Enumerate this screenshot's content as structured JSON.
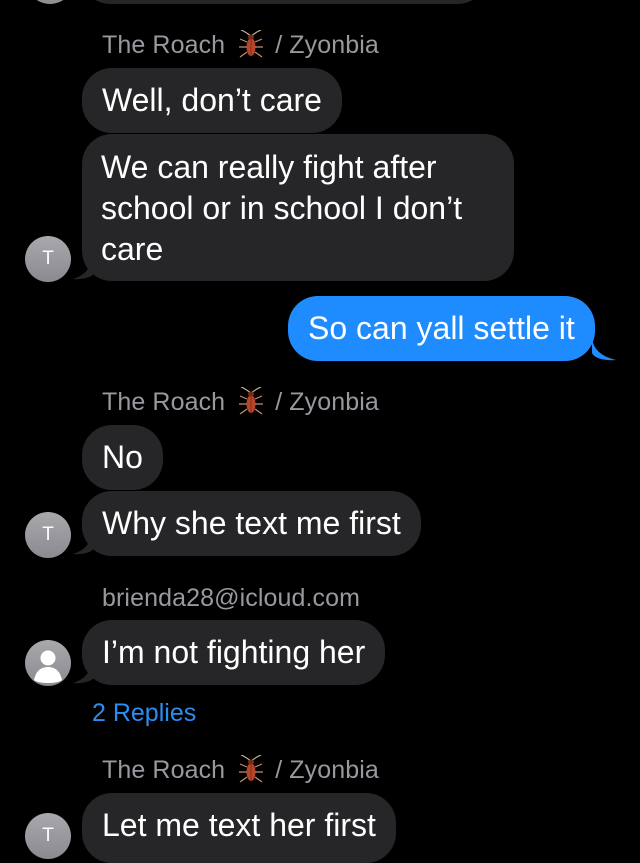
{
  "colors": {
    "background": "#000000",
    "incoming_bubble": "#262628",
    "outgoing_bubble": "#1e8bff",
    "sender_text": "#98989f",
    "link": "#2b8cf2"
  },
  "senders": {
    "roach": {
      "name": "The Roach",
      "suffix": "/ Zyonbia",
      "icon": "cockroach-icon",
      "avatar_initial": "T"
    },
    "brienda": {
      "name": "brienda28@icloud.com",
      "icon": "person-silhouette-icon"
    }
  },
  "messages": [
    {
      "text": "Well, don’t care"
    },
    {
      "text": "We can really fight after school or in school I don’t care"
    },
    {
      "text": "So can yall settle it"
    },
    {
      "text": "No"
    },
    {
      "text": "Why she text me first"
    },
    {
      "text": "I’m not fighting her"
    },
    {
      "text": "Let me text her first"
    }
  ],
  "thread": {
    "replies_label": "2 Replies"
  }
}
